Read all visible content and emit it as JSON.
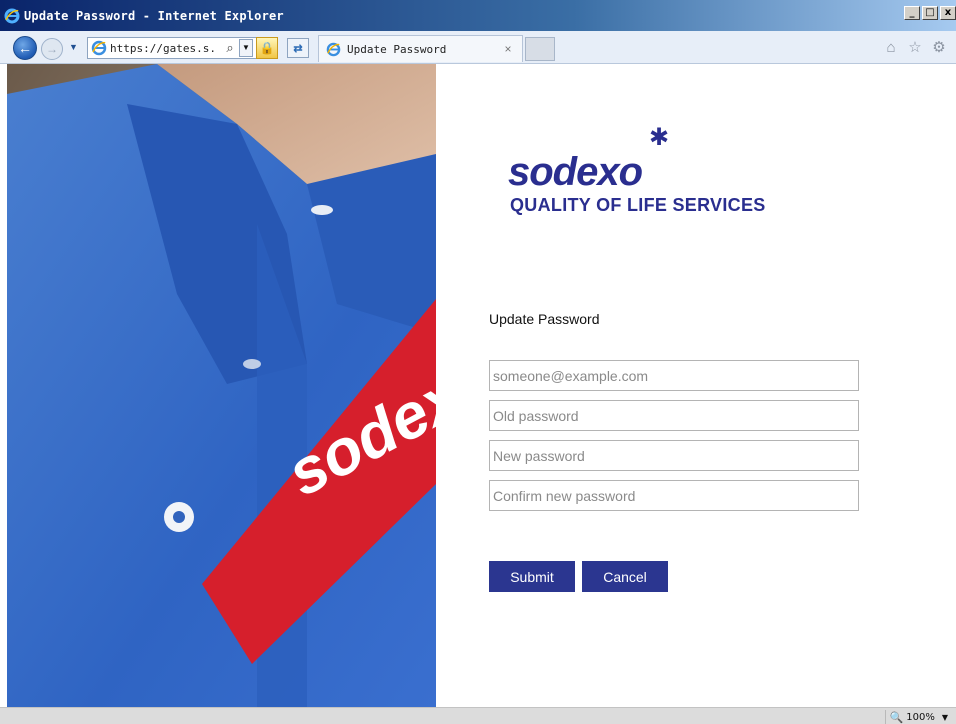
{
  "window": {
    "title": "Update Password - Internet Explorer",
    "minimize": "_",
    "maximize": "□",
    "close": "x"
  },
  "navbar": {
    "address_main": "https://gates.s.",
    "address_secure_icon": "lock-icon",
    "tab_label": "Update Password",
    "tab_close": "×"
  },
  "logo": {
    "wordmark": "sodexo",
    "tagline": "QUALITY OF LIFE SERVICES",
    "accent_color": "#2a2e8f"
  },
  "photo": {
    "shirt_text": "sodexo"
  },
  "form": {
    "title": "Update Password",
    "email_placeholder": "someone@example.com",
    "old_password_placeholder": "Old password",
    "new_password_placeholder": "New password",
    "confirm_password_placeholder": "Confirm new password",
    "submit_label": "Submit",
    "cancel_label": "Cancel",
    "button_color": "#2b3690"
  },
  "statusbar": {
    "zoom": "100%"
  }
}
